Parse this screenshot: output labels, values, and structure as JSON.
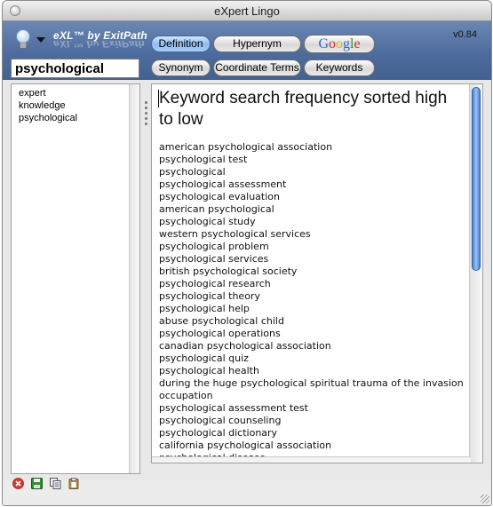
{
  "window": {
    "title": "eXpert Lingo",
    "version": "v0.84"
  },
  "header": {
    "brand": "eXL™ by ExitPath"
  },
  "search": {
    "value": "psychological"
  },
  "tabs": {
    "definition": "Definition",
    "hypernym": "Hypernym",
    "google_letters": [
      {
        "ch": "G",
        "color": "#3366cc"
      },
      {
        "ch": "o",
        "color": "#cc3333"
      },
      {
        "ch": "o",
        "color": "#e8b300"
      },
      {
        "ch": "g",
        "color": "#3366cc"
      },
      {
        "ch": "l",
        "color": "#2d9a3a"
      },
      {
        "ch": "e",
        "color": "#cc3333"
      }
    ],
    "synonym": "Synonym",
    "coordinate_terms": "Coordinate Terms",
    "keywords": "Keywords",
    "active": "Definition"
  },
  "history": {
    "items": [
      "expert",
      "knowledge",
      "psychological"
    ]
  },
  "main": {
    "title": "Keyword search frequency sorted high to low",
    "results": [
      "american psychological association",
      "psychological test",
      "psychological",
      "psychological assessment",
      "psychological evaluation",
      "american psychological",
      "psychological study",
      "western psychological services",
      "psychological problem",
      "psychological services",
      "british psychological society",
      "psychological research",
      "psychological theory",
      "psychological help",
      "abuse psychological child",
      "psychological operations",
      "canadian psychological association",
      "psychological quiz",
      "psychological health",
      "during the huge psychological spiritual trauma of the invasion occupation",
      "psychological assessment test",
      "psychological counseling",
      "psychological dictionary",
      "california psychological association",
      "psychological disease"
    ]
  },
  "statusbar": {
    "icons": [
      "clear-icon",
      "save-icon",
      "copy-icon",
      "paste-icon"
    ]
  },
  "colors": {
    "header_top": "#6b87b4",
    "header_bottom": "#44628f",
    "active_tab": "#8fbcef",
    "scroll_thumb": "#4d82d1"
  }
}
